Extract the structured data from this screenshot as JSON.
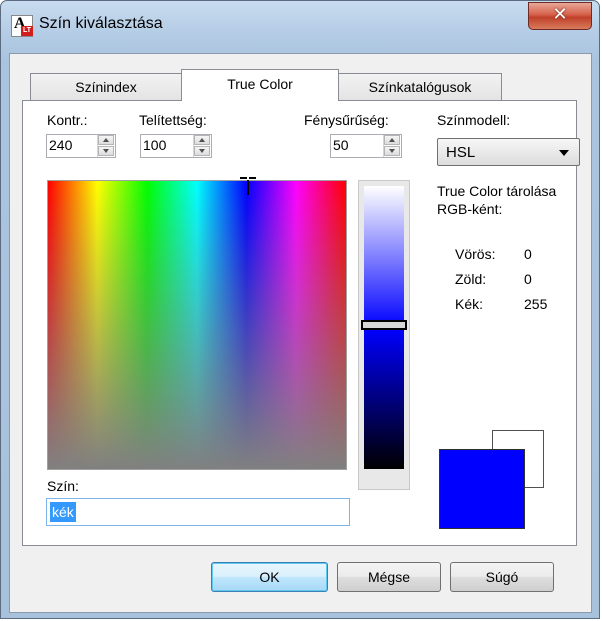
{
  "window": {
    "title": "Szín kiválasztása",
    "close_glyph": "✕"
  },
  "tabs": [
    {
      "label": "Színindex",
      "active": false
    },
    {
      "label": "True Color",
      "active": true
    },
    {
      "label": "Színkatalógusok",
      "active": false
    }
  ],
  "controls": {
    "contrast": {
      "label": "Kontr.:",
      "value": "240"
    },
    "saturation": {
      "label": "Telítettség:",
      "value": "100"
    },
    "luminance": {
      "label": "Fénysűrűség:",
      "value": "50"
    },
    "color_model": {
      "label": "Színmodell:",
      "value": "HSL"
    }
  },
  "rgb_info": {
    "heading_line1": "True Color tárolása",
    "heading_line2": "RGB-ként:",
    "rows": [
      {
        "label": "Vörös:",
        "value": "0"
      },
      {
        "label": "Zöld:",
        "value": "0"
      },
      {
        "label": "Kék:",
        "value": "255"
      }
    ]
  },
  "color_name": {
    "label": "Szín:",
    "value": "kék"
  },
  "swatches": {
    "new_color": "#0000ff",
    "old_color": "#ffffff"
  },
  "buttons": {
    "ok": "OK",
    "cancel": "Mégse",
    "help": "Súgó"
  },
  "icons": [
    "app-icon",
    "close-icon",
    "chevron-down-icon",
    "spin-up-icon",
    "spin-down-icon"
  ]
}
